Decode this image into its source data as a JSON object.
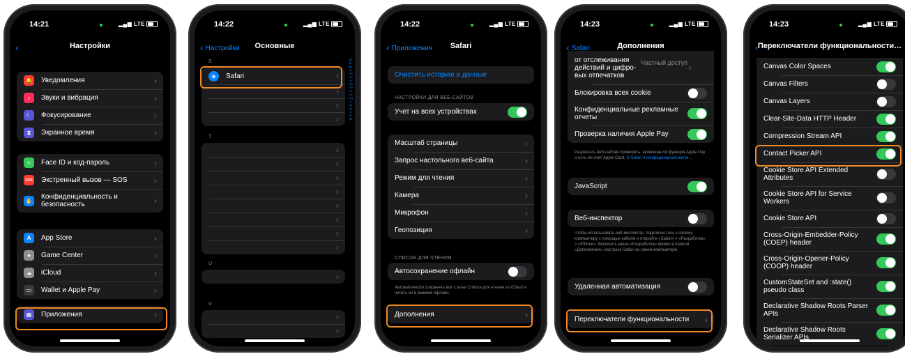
{
  "colors": {
    "accent": "#0a84ff",
    "highlight": "#f08a24",
    "toggle_on": "#34c759",
    "toggle_off": "#39393d"
  },
  "phones": [
    {
      "time": "14:21",
      "signal": "LTE",
      "title": "Настройки",
      "back": "",
      "groups": [
        {
          "items": [
            {
              "label": "Уведомления",
              "icon": "bell-icon",
              "color": "#ff3b30"
            },
            {
              "label": "Звуки и вибрация",
              "icon": "speaker-icon",
              "color": "#ff2d55"
            },
            {
              "label": "Фокусирование",
              "icon": "moon-icon",
              "color": "#5856d6"
            },
            {
              "label": "Экранное время",
              "icon": "hourglass-icon",
              "color": "#5856d6"
            }
          ]
        },
        {
          "items": [
            {
              "label": "Face ID и код-пароль",
              "icon": "faceid-icon",
              "color": "#34c759"
            },
            {
              "label": "Экстренный вызов — SOS",
              "icon": "sos-icon",
              "color": "#ff3b30"
            },
            {
              "label": "Конфиденциальность и безопасность",
              "icon": "hand-icon",
              "color": "#0a84ff"
            }
          ]
        },
        {
          "items": [
            {
              "label": "App Store",
              "icon": "appstore-icon",
              "color": "#0a84ff"
            },
            {
              "label": "Game Center",
              "icon": "gamecenter-icon",
              "color": "#8e8e93"
            },
            {
              "label": "iCloud",
              "icon": "cloud-icon",
              "color": "#8e8e93"
            },
            {
              "label": "Wallet и Apple Pay",
              "icon": "wallet-icon",
              "color": "#3a3a3c"
            }
          ]
        },
        {
          "items": [
            {
              "label": "Приложения",
              "icon": "apps-icon",
              "color": "#5856d6"
            }
          ]
        }
      ]
    },
    {
      "time": "14:22",
      "signal": "LTE",
      "title": "Основные",
      "back": "Настройки",
      "sections": [
        {
          "letter": "S",
          "rows": [
            "Safari",
            "",
            "",
            ""
          ]
        },
        {
          "letter": "T",
          "rows": [
            "",
            "",
            "",
            "",
            "",
            "",
            "",
            ""
          ]
        },
        {
          "letter": "U",
          "rows": [
            ""
          ]
        },
        {
          "letter": "V",
          "rows": [
            "",
            ""
          ]
        }
      ],
      "index": "АБВГДЕЖЗИКЛМНОПРСТУФХЦЧШЩЭЮЯ#"
    },
    {
      "time": "14:22",
      "signal": "LTE",
      "title": "Safari",
      "back": "Приложения",
      "clear_history": "Очистить историю и данные",
      "section_websites": "НАСТРОЙКИ ДЛЯ ВЕБ-САЙТОВ",
      "share_devices": "Учет на всех устройствах",
      "site_rows": [
        "Масштаб страницы",
        "Запрос настольного веб-сайта",
        "Режим для чтения",
        "Камера",
        "Микрофон",
        "Геопозиция"
      ],
      "section_reading": "СПИСОК ДЛЯ ЧТЕНИЯ",
      "auto_save": "Автосохранение офлайн",
      "auto_save_note": "Автоматически сохранять все статьи Списка для чтения из iCloud и читать их в режиме офлайн.",
      "advanced": "Дополнения"
    },
    {
      "time": "14:23",
      "signal": "LTE",
      "title": "Дополнения",
      "back": "Safari",
      "tracking_label": "от отслеживания действий и цифро-вых отпечатков",
      "tracking_value": "Частный доступ",
      "block_cookies": "Блокировка всех cookie",
      "private_ads": "Конфиденциальные рекламные отчеты",
      "apple_pay": "Проверка наличия Apple Pay",
      "apple_pay_note": "Разрешать веб-сайтам проверять, включена ли функция Apple Pay и есть ли счет Apple Card.",
      "apple_pay_link": "О Safari и конфиденциальности…",
      "javascript": "JavaScript",
      "web_inspector": "Веб-инспектор",
      "inspector_note": "Чтобы использовать веб-инспектор, подключи-тесь к своему компьютеру с помощью кабеля и откройте «Safari» > «Разработка» > «iPhone». Включить меню «Разработка» можно в панели «Дополнения» настроек Safari на своем компьютере.",
      "remote_automation": "Удаленная автоматизация",
      "feature_flags": "Переключатели функциональности"
    },
    {
      "time": "14:23",
      "signal": "LTE",
      "title": "Переключатели функциональности…",
      "back": "",
      "flags": [
        {
          "label": "Canvas Color Spaces",
          "on": true
        },
        {
          "label": "Canvas Filters",
          "on": false
        },
        {
          "label": "Canvas Layers",
          "on": false
        },
        {
          "label": "Clear-Site-Data HTTP Header",
          "on": true
        },
        {
          "label": "Compression Stream API",
          "on": true
        },
        {
          "label": "Contact Picker API",
          "on": true
        },
        {
          "label": "Cookie Store API Extended Attributes",
          "on": false
        },
        {
          "label": "Cookie Store API for Service Workers",
          "on": false
        },
        {
          "label": "Cookie Store API",
          "on": false
        },
        {
          "label": "Cross-Origin-Embedder-Policy (COEP) header",
          "on": true
        },
        {
          "label": "Cross-Origin-Opener-Policy (COOP) header",
          "on": true
        },
        {
          "label": "CustomStateSet and :state() pseudo class",
          "on": true
        },
        {
          "label": "Declarative Shadow Roots Parser APIs",
          "on": true
        },
        {
          "label": "Declarative Shadow Roots Serializer APIs",
          "on": true
        }
      ]
    }
  ]
}
